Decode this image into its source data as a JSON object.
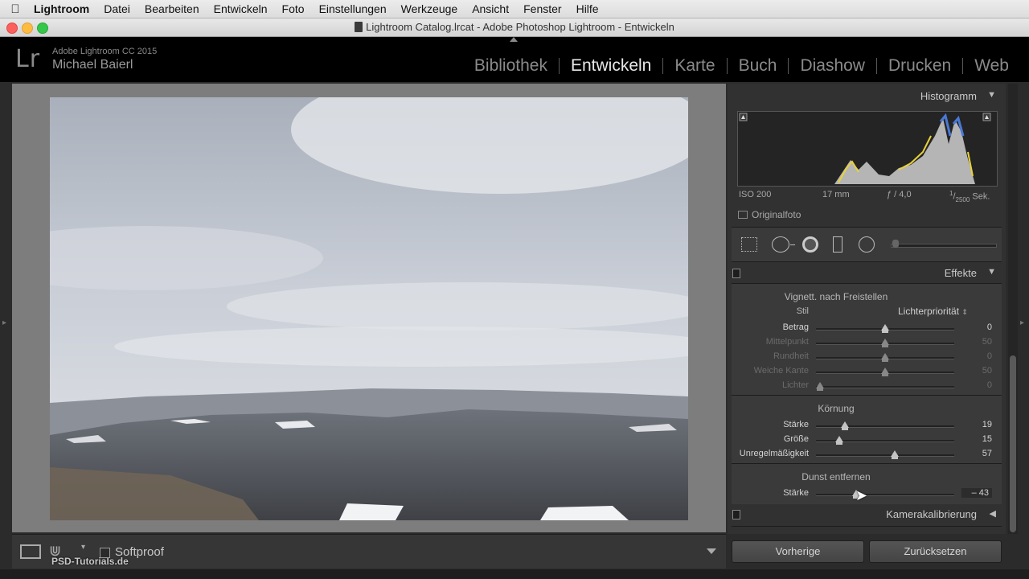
{
  "menubar": {
    "app": "Lightroom",
    "items": [
      "Datei",
      "Bearbeiten",
      "Entwickeln",
      "Foto",
      "Einstellungen",
      "Werkzeuge",
      "Ansicht",
      "Fenster",
      "Hilfe"
    ]
  },
  "window": {
    "title": "Lightroom Catalog.lrcat - Adobe Photoshop Lightroom - Entwickeln"
  },
  "identity": {
    "logo": "Lr",
    "product": "Adobe Lightroom CC 2015",
    "user": "Michael Baierl"
  },
  "modules": {
    "active": "Entwickeln",
    "items": [
      "Bibliothek",
      "Entwickeln",
      "Karte",
      "Buch",
      "Diashow",
      "Drucken",
      "Web"
    ]
  },
  "histogram": {
    "title": "Histogramm",
    "iso": "ISO 200",
    "focal": "17 mm",
    "aperture": "ƒ / 4,0",
    "shutter_num": "1",
    "shutter_den": "2500",
    "shutter_unit": "Sek.",
    "original_label": "Originalfoto"
  },
  "effects": {
    "title": "Effekte",
    "vignette": {
      "title": "Vignett. nach Freistellen",
      "style_label": "Stil",
      "style_value": "Lichterpriorität",
      "sliders": [
        {
          "label": "Betrag",
          "value": "0",
          "pos": 0.5,
          "enabled": true
        },
        {
          "label": "Mittelpunkt",
          "value": "50",
          "pos": 0.5,
          "enabled": false
        },
        {
          "label": "Rundheit",
          "value": "0",
          "pos": 0.5,
          "enabled": false
        },
        {
          "label": "Weiche Kante",
          "value": "50",
          "pos": 0.5,
          "enabled": false
        },
        {
          "label": "Lichter",
          "value": "0",
          "pos": 0.03,
          "enabled": false
        }
      ]
    },
    "grain": {
      "title": "Körnung",
      "sliders": [
        {
          "label": "Stärke",
          "value": "19",
          "pos": 0.21,
          "enabled": true
        },
        {
          "label": "Größe",
          "value": "15",
          "pos": 0.17,
          "enabled": true
        },
        {
          "label": "Unregelmäßigkeit",
          "value": "57",
          "pos": 0.57,
          "enabled": true
        }
      ]
    },
    "dehaze": {
      "title": "Dunst entfernen",
      "sliders": [
        {
          "label": "Stärke",
          "value": "– 43",
          "pos": 0.29,
          "enabled": true
        }
      ]
    }
  },
  "calibration": {
    "title": "Kamerakalibrierung"
  },
  "toolbar": {
    "softproof_label": "Softproof",
    "watermark": "PSD-Tutorials.de"
  },
  "buttons": {
    "previous": "Vorherige",
    "reset": "Zurücksetzen"
  }
}
